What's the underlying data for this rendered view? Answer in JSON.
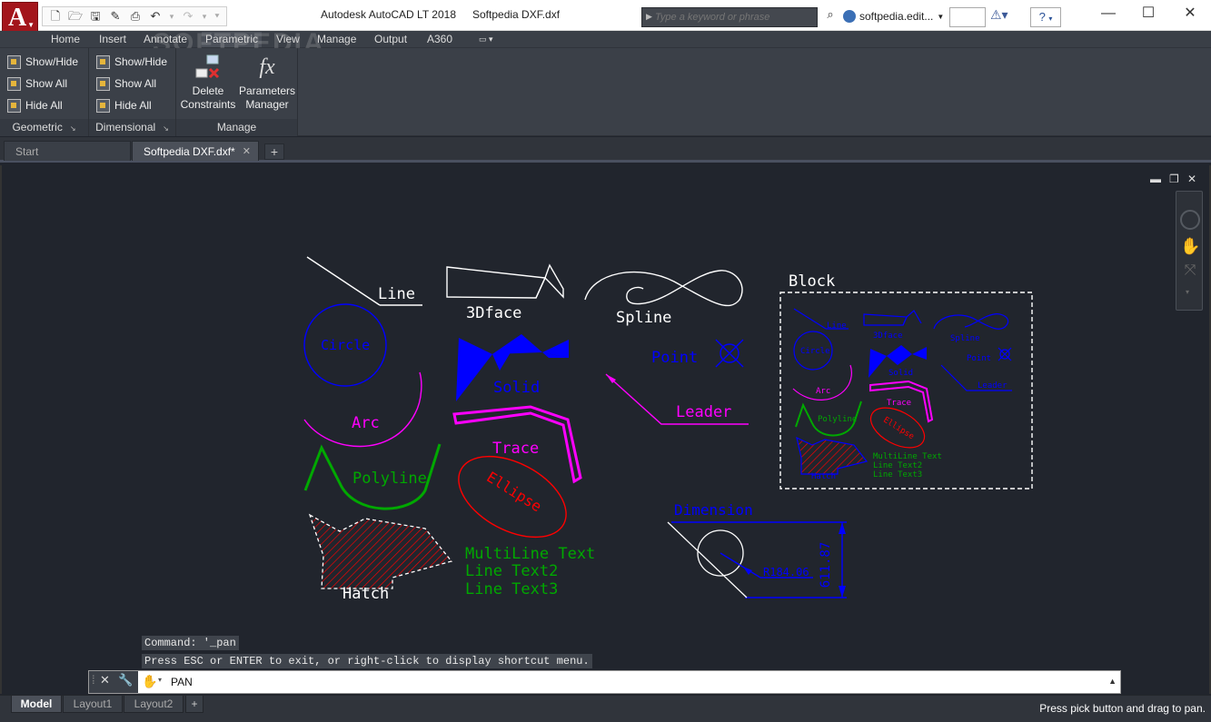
{
  "app": {
    "logo_letter": "A",
    "logo_sub": "LT",
    "title": "Autodesk AutoCAD LT 2018",
    "file": "Softpedia DXF.dxf",
    "watermark": "SOFTPEDIA"
  },
  "search": {
    "placeholder": "Type a keyword or phrase"
  },
  "user": {
    "name": "softpedia.edit..."
  },
  "menu": [
    "Home",
    "Insert",
    "Annotate",
    "Parametric",
    "View",
    "Manage",
    "Output",
    "A360"
  ],
  "ribbon": {
    "geometric": {
      "items": [
        "Show/Hide",
        "Show All",
        "Hide All"
      ],
      "title": "Geometric"
    },
    "dimensional": {
      "items": [
        "Show/Hide",
        "Show All",
        "Hide All"
      ],
      "title": "Dimensional"
    },
    "manage": {
      "delete_label_1": "Delete",
      "delete_label_2": "Constraints",
      "params_label_1": "Parameters",
      "params_label_2": "Manager",
      "fx": "fx",
      "title": "Manage"
    }
  },
  "doc_tabs": {
    "start": "Start",
    "file": "Softpedia DXF.dxf*"
  },
  "drawing": {
    "labels": {
      "line": "Line",
      "face": "3Dface",
      "spline": "Spline",
      "block": "Block",
      "circle": "Circle",
      "solid": "Solid",
      "point": "Point",
      "leader": "Leader",
      "arc": "Arc",
      "trace": "Trace",
      "polyline": "Polyline",
      "ellipse": "Ellipse",
      "hatch": "Hatch",
      "mtext1": "MultiLine Text",
      "mtext2": "Line Text2",
      "mtext3": "Line Text3",
      "dimension": "Dimension",
      "dim_radius": "R184.06",
      "dim_vertical": "611.87"
    },
    "colors": {
      "white": "#ffffff",
      "blue": "#0000ff",
      "magenta": "#ff00ff",
      "green": "#00a800",
      "red": "#ff0000"
    }
  },
  "command": {
    "history_1": "Command: '_pan",
    "history_2": "Press ESC or ENTER to exit, or right-click to display shortcut menu.",
    "current": "PAN"
  },
  "layouts": [
    "Model",
    "Layout1",
    "Layout2"
  ],
  "status_text": "Press pick button and drag to pan."
}
